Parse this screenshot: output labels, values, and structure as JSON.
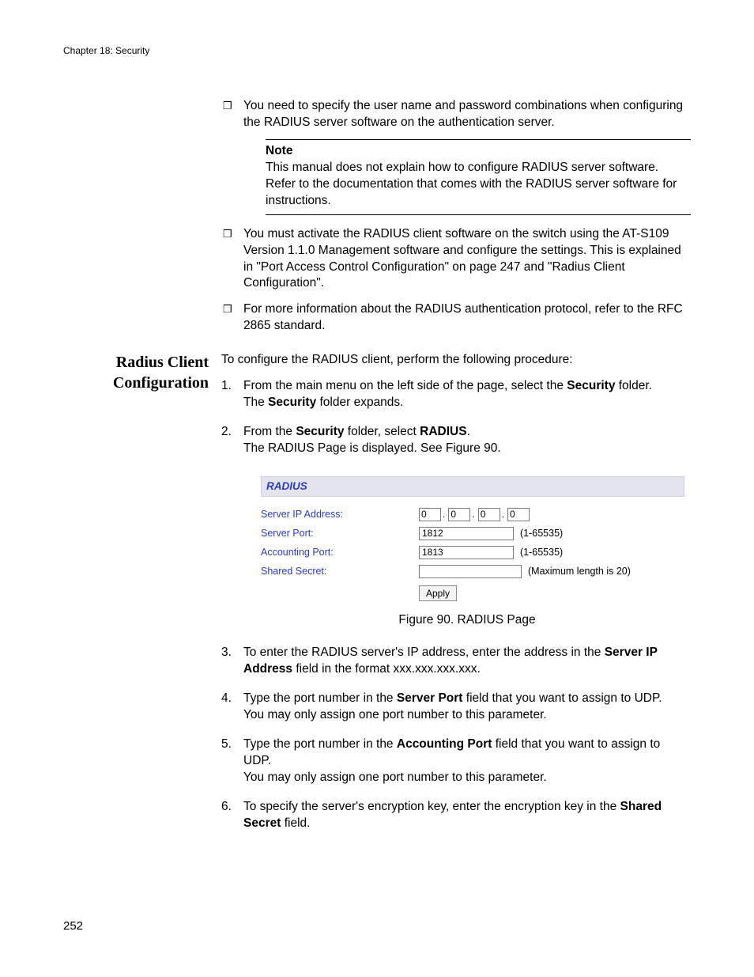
{
  "header": {
    "chapter": "Chapter 18: Security"
  },
  "bullets": {
    "b1": "You need to specify the user name and password combinations when configuring the RADIUS server software on the authentication server.",
    "b2": "You must activate the RADIUS client software on the switch using the AT-S109 Version 1.1.0  Management software and configure the settings. This is explained in \"Port Access Control Configuration\" on page 247 and \"Radius Client Configuration\".",
    "b3": "For more information about the RADIUS authentication protocol, refer to the RFC 2865 standard."
  },
  "note": {
    "label": "Note",
    "body": "This manual does not explain how to configure RADIUS server software. Refer to the documentation that comes with the RADIUS server software for instructions."
  },
  "section": {
    "heading_l1": "Radius Client",
    "heading_l2": "Configuration",
    "intro": "To configure the RADIUS client, perform the following procedure:"
  },
  "steps": {
    "s1a": "From the main menu on the left side of the page, select the ",
    "s1b": "Security",
    "s1c": " folder.",
    "s1d": "The ",
    "s1e": "Security",
    "s1f": " folder expands.",
    "s2a": "From the ",
    "s2b": "Security",
    "s2c": " folder, select ",
    "s2d": "RADIUS",
    "s2e": ".",
    "s2f": "The RADIUS Page is displayed. See Figure 90.",
    "s3a": "To enter the RADIUS server's IP address, enter the address in the ",
    "s3b": "Server IP Address",
    "s3c": " field in the format xxx.xxx.xxx.xxx.",
    "s4a": "Type the port number in the ",
    "s4b": "Server Port",
    "s4c": " field that you want to assign to UDP.",
    "s4d": "You may only assign one port number to this parameter.",
    "s5a": "Type the port number in the ",
    "s5b": "Accounting Port",
    "s5c": " field that you want to assign to UDP.",
    "s5d": "You may only assign one port number to this parameter.",
    "s6a": "To specify the server's encryption key, enter the encryption key in the ",
    "s6b": "Shared Secret",
    "s6c": " field."
  },
  "radius": {
    "title": "RADIUS",
    "server_ip_label": "Server IP Address:",
    "server_port_label": "Server Port:",
    "accounting_port_label": "Accounting Port:",
    "shared_secret_label": "Shared Secret:",
    "ip1": "0",
    "ip2": "0",
    "ip3": "0",
    "ip4": "0",
    "server_port_val": "1812",
    "accounting_port_val": "1813",
    "port_hint": "(1-65535)",
    "secret_hint": "(Maximum length is 20)",
    "apply": "Apply",
    "dot": "."
  },
  "figure_caption": "Figure 90. RADIUS Page",
  "page_number": "252"
}
